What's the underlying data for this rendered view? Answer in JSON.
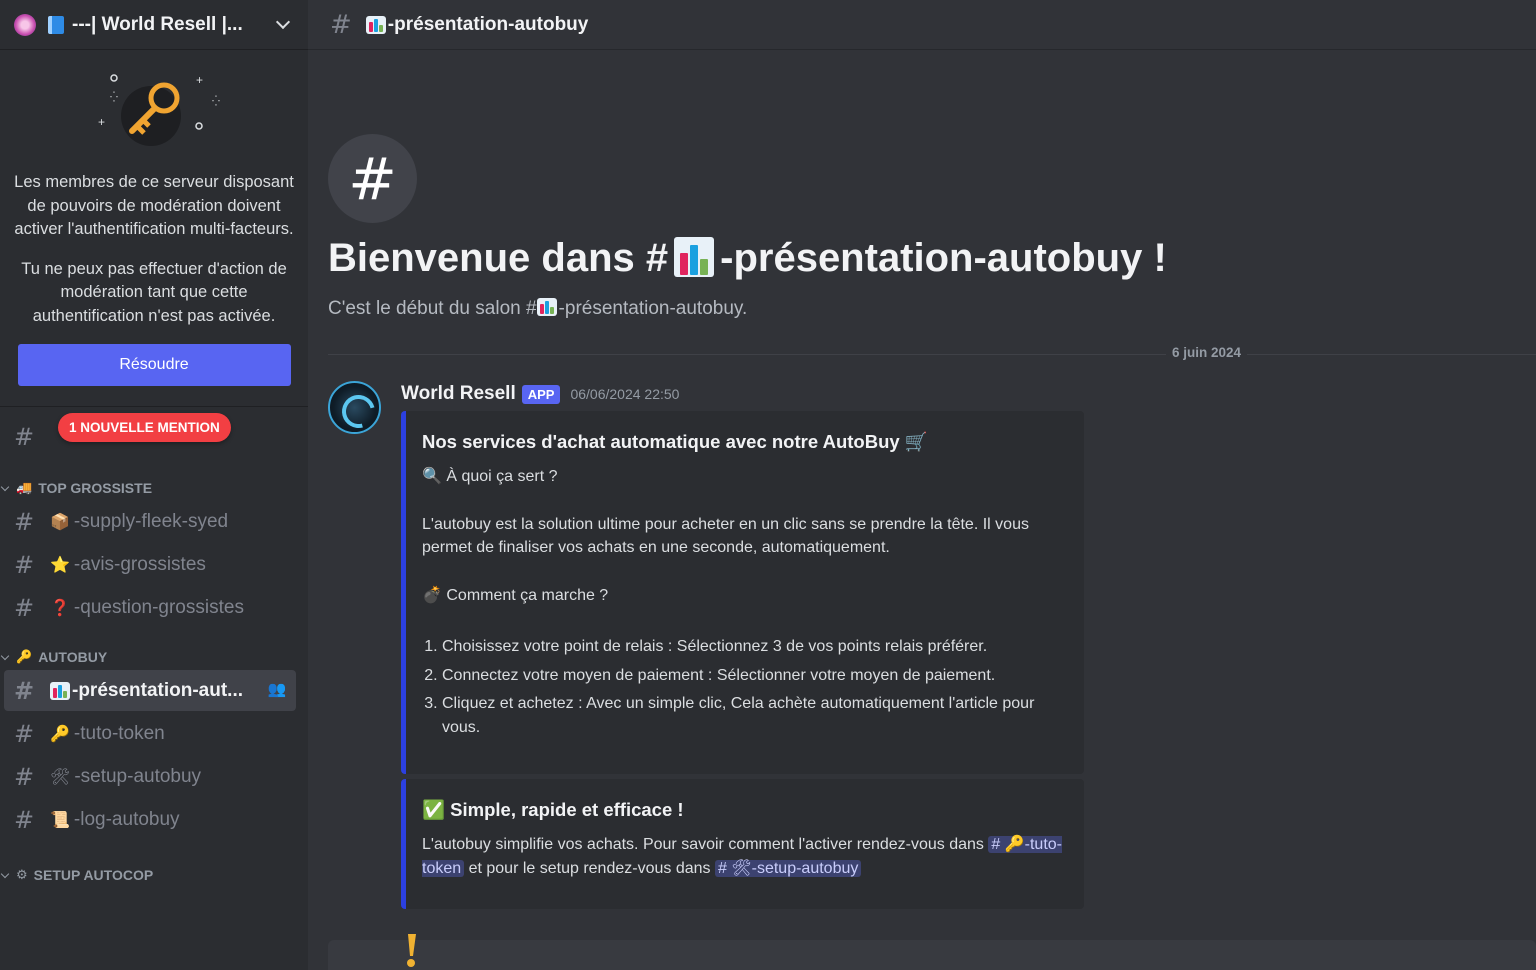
{
  "server": {
    "name": "---| World Resell |...",
    "icon": "server-avatar",
    "emoji": "blue-book-emoji"
  },
  "mfa": {
    "paragraph1": "Les membres de ce serveur disposant de pouvoirs de modération doivent activer l'authentification multi-facteurs.",
    "paragraph2": "Tu ne peux pas effectuer d'action de modération tant que cette authentification n'est pas activée.",
    "resolve_label": "Résoudre"
  },
  "mention_pill": "1 NOUVELLE MENTION",
  "categories": [
    {
      "name": "TOP GROSSISTE",
      "emoji": "🚚",
      "channels": [
        {
          "emoji": "📦",
          "name": "-supply-fleek-syed"
        },
        {
          "emoji": "⭐",
          "name": "-avis-grossistes"
        },
        {
          "emoji": "❓",
          "name": "-question-grossistes"
        }
      ]
    },
    {
      "name": "AUTOBUY",
      "emoji": "🔑",
      "channels": [
        {
          "emoji": "chart",
          "name": "-présentation-aut...",
          "active": true
        },
        {
          "emoji": "🔑",
          "name": "-tuto-token"
        },
        {
          "emoji": "🛠",
          "name": "-setup-autobuy"
        },
        {
          "emoji": "📜",
          "name": "-log-autobuy"
        }
      ]
    },
    {
      "name": "SETUP AUTOCOP",
      "emoji": "⚙"
    }
  ],
  "topbar": {
    "channel_name": "-présentation-autobuy"
  },
  "welcome": {
    "title_prefix": "Bienvenue dans #",
    "title_suffix": "-présentation-autobuy !",
    "sub_prefix": "C'est le début du salon #",
    "sub_suffix": "-présentation-autobuy."
  },
  "date_divider": "6 juin 2024",
  "message": {
    "author": "World Resell",
    "badge": "APP",
    "timestamp": "06/06/2024 22:50",
    "embed1": {
      "title": "Nos services d'achat automatique avec notre AutoBuy 🛒",
      "q1": "🔍 À quoi ça sert ?",
      "p1": "L'autobuy est la solution ultime pour acheter en un clic sans se prendre la tête. Il vous permet de finaliser vos achats en une seconde, automatiquement.",
      "q2": "💣 Comment ça marche ?",
      "steps": [
        "Choisissez votre point de relais : Sélectionnez 3 de vos points relais préférer.",
        "Connectez votre moyen de paiement : Sélectionner votre moyen de paiement.",
        "Cliquez et achetez : Avec un simple clic, Cela achète automatiquement l'article pour vous."
      ]
    },
    "embed2": {
      "title": "✅ Simple, rapide et efficace !",
      "text1": "L'autobuy simplifie vos achats. Pour savoir comment l'activer rendez-vous dans ",
      "mention1": "# 🔑-tuto-token",
      "text2": " et pour le setup rendez-vous dans ",
      "mention2": "# 🛠-setup-autobuy"
    }
  },
  "colors": {
    "accent": "#5865f2",
    "embed_border": "#2c40e0",
    "mention_red": "#f23f43",
    "background": "#313338",
    "sidebar": "#2b2d31"
  }
}
